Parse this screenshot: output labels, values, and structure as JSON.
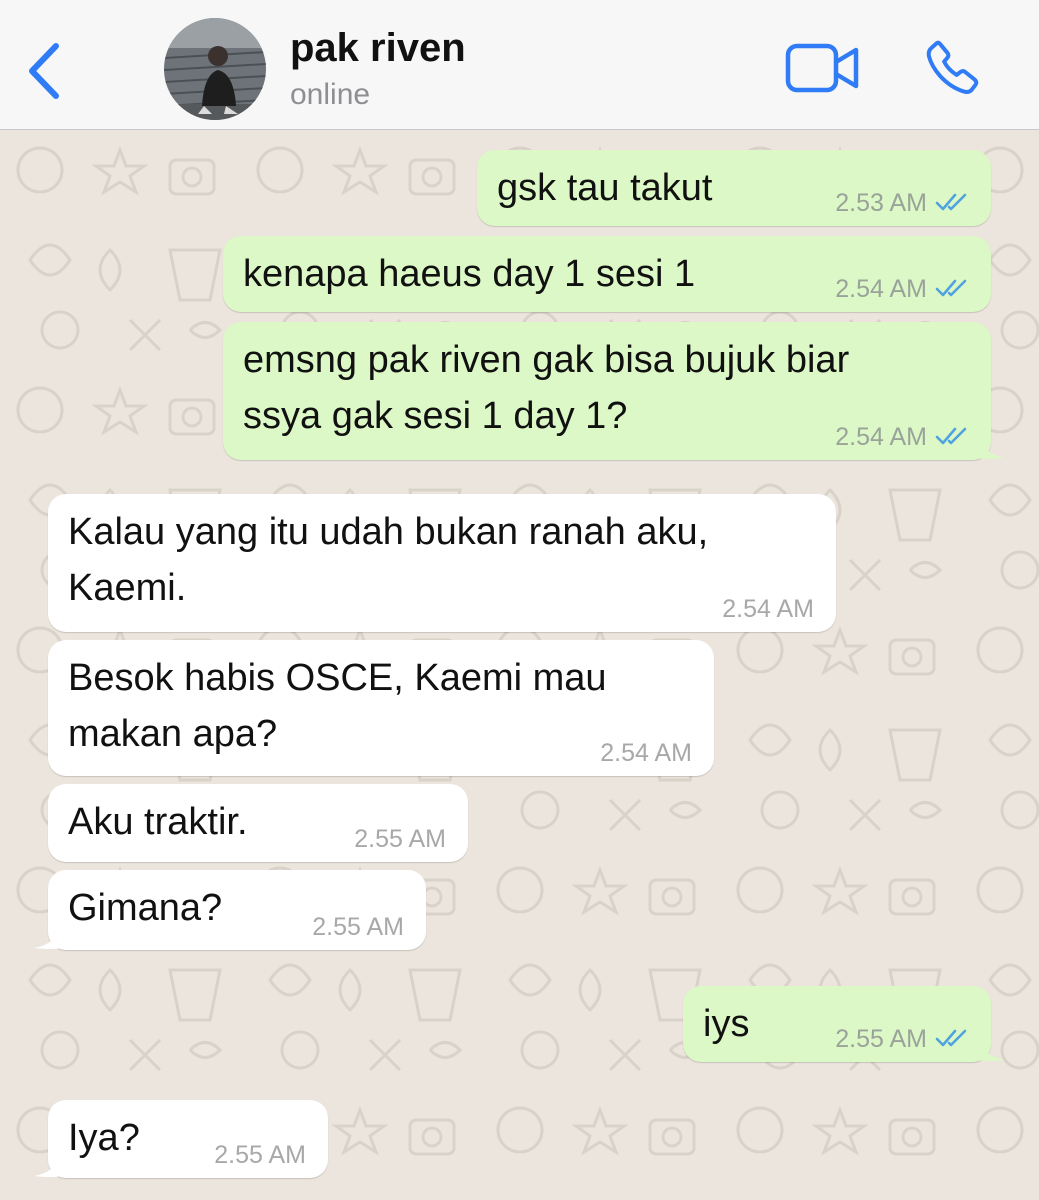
{
  "header": {
    "contact_name": "pak riven",
    "status": "online"
  },
  "colors": {
    "accent": "#2f7cf6",
    "outgoing_bubble": "#dcf8c6",
    "incoming_bubble": "#ffffff",
    "wallpaper": "#ece5dd",
    "read_ticks": "#4fa3e0"
  },
  "icons": {
    "back": "chevron-left-icon",
    "video": "video-camera-icon",
    "call": "phone-icon",
    "read_status": "double-check-icon"
  },
  "messages": [
    {
      "direction": "out",
      "lines": [
        "gsk tau takut"
      ],
      "time": "2.53 AM",
      "read": true
    },
    {
      "direction": "out",
      "lines": [
        "kenapa haeus day 1 sesi 1"
      ],
      "time": "2.54 AM",
      "read": true
    },
    {
      "direction": "out",
      "lines": [
        "emsng pak riven gak bisa bujuk biar",
        "ssya gak sesi 1 day 1?"
      ],
      "time": "2.54 AM",
      "read": true
    },
    {
      "direction": "in",
      "lines": [
        "Kalau yang itu udah bukan ranah aku,",
        "Kaemi."
      ],
      "time": "2.54 AM"
    },
    {
      "direction": "in",
      "lines": [
        "Besok habis OSCE, Kaemi mau",
        "makan apa?"
      ],
      "time": "2.54 AM"
    },
    {
      "direction": "in",
      "lines": [
        "Aku traktir."
      ],
      "time": "2.55 AM"
    },
    {
      "direction": "in",
      "lines": [
        "Gimana?"
      ],
      "time": "2.55 AM"
    },
    {
      "direction": "out",
      "lines": [
        "iys"
      ],
      "time": "2.55 AM",
      "read": true
    },
    {
      "direction": "in",
      "lines": [
        "Iya?"
      ],
      "time": "2.55 AM"
    }
  ]
}
